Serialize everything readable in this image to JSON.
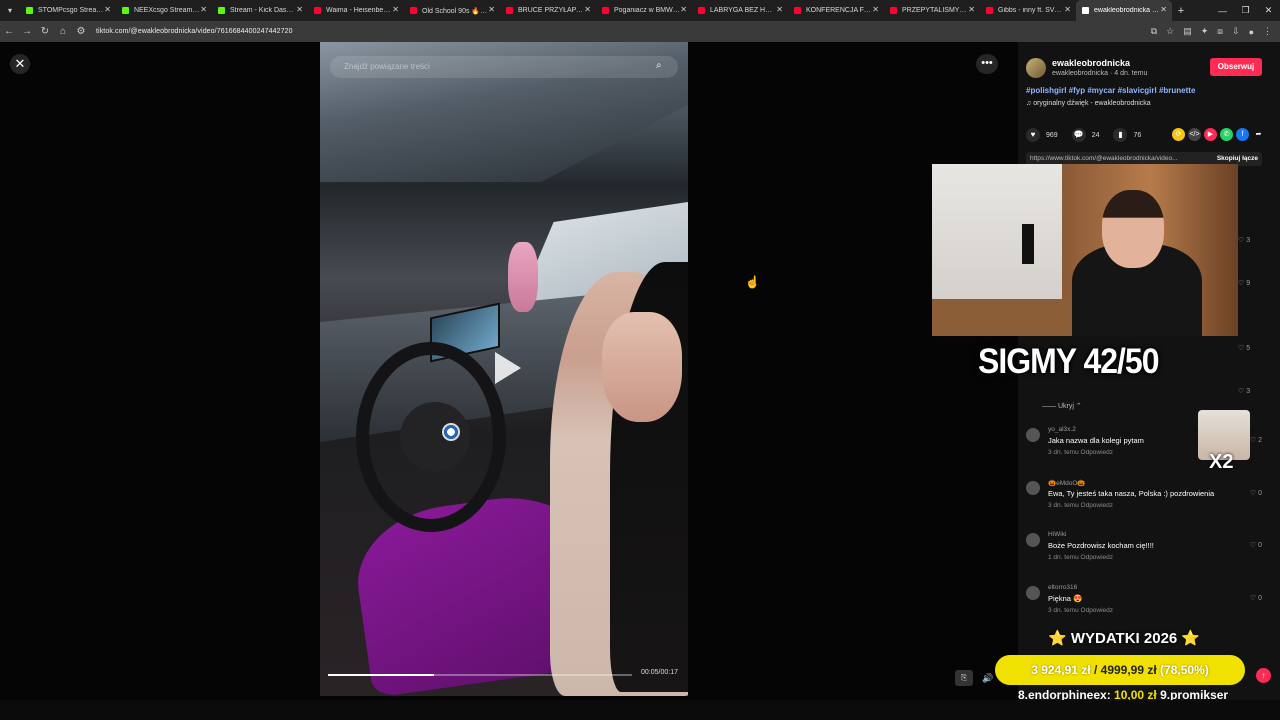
{
  "browser": {
    "tabs": [
      {
        "title": "STOMPcsgo Stream - …",
        "color": "#53fc18"
      },
      {
        "title": "NEEXcsgo Stream - W…",
        "color": "#53fc18"
      },
      {
        "title": "Stream - Kick Dashbo…",
        "color": "#53fc18"
      },
      {
        "title": "Waima - Heisenberg ft…",
        "color": "#ff0033"
      },
      {
        "title": "Old School 90s 🔥 Emi…",
        "color": "#ff0033"
      },
      {
        "title": "BRUCE PRZYŁAPANY …",
        "color": "#ff0033"
      },
      {
        "title": "Poganiacz w BMW - p…",
        "color": "#ff0033"
      },
      {
        "title": "LABRYGA BEZ HAMUL…",
        "color": "#ff0033"
      },
      {
        "title": "KONFERENCJA FAME …",
        "color": "#ff0033"
      },
      {
        "title": "PRZEPYTALIŚMY ich o…",
        "color": "#ff0033"
      },
      {
        "title": "Gibbs - inny ft. SVM!…",
        "color": "#ff0033"
      },
      {
        "title": "ewakleobrodnicka (@…",
        "color": "#ffffff"
      }
    ],
    "url": "tiktok.com/@ewakleobrodnicka/video/7616684400247442720"
  },
  "video": {
    "search_placeholder": "Znajdź powiązane treści",
    "time": "00:05/00:17",
    "progress": 0.35
  },
  "author": {
    "name": "ewakleobrodnicka",
    "meta": "ewakleobrodnicka · 4 dn. temu",
    "follow_label": "Obserwuj",
    "hashtags": "#polishgirl #fyp #mycar #slavicgirl #brunette",
    "sound": "♫  oryginalny dźwięk - ewakleobrodnicka",
    "likes": "969",
    "comments": "24",
    "saves": "76",
    "link": "https://www.tiktok.com/@ewakleobrodnicka/video...",
    "copy_link": "Skopiuj łącze"
  },
  "comment_likes_right": [
    "3",
    "9",
    "5",
    "3"
  ],
  "hide_replies": "—— Ukryj ⌃",
  "comments": [
    {
      "user": "yo_al3x.2",
      "text": "Jaka nazwa dla kolegi pytam",
      "meta": "3 dn. temu    Odpowiedz",
      "likes": "♡ 2"
    },
    {
      "user": "🎃eMdoO🎃",
      "text": "Ewa, Ty jesteś taka nasza, Polska :) pozdrowienia",
      "meta": "3 dn. temu    Odpowiedz",
      "likes": "♡ 0"
    },
    {
      "user": "HiWiki",
      "text": "Boże Pozdrowisz kocham cię!!!!",
      "meta": "1 dn. temu    Odpowiedz",
      "likes": "♡ 0"
    },
    {
      "user": "eltorro316",
      "text": "Piękna 😍",
      "meta": "3 dn. temu    Odpowiedz",
      "likes": "♡ 0"
    }
  ],
  "overlay": {
    "sigmy": "SIGMY 42/50",
    "x2": "X2",
    "wydatki_title": "⭐ WYDATKI 2026 ⭐",
    "wydatki_amount": "3 924,91 zł",
    "wydatki_sep": " / ",
    "wydatki_goal": "4999,99 zł",
    "wydatki_pct": " (78,50%)",
    "donor_a": "8.endorphineex: ",
    "donor_a_amt": "10,00 zł",
    "donor_b": "  9.promikser"
  },
  "colors": {
    "accent": "#fe2c55",
    "hashtag": "#8fb7ff",
    "bar": "#f1e100"
  }
}
